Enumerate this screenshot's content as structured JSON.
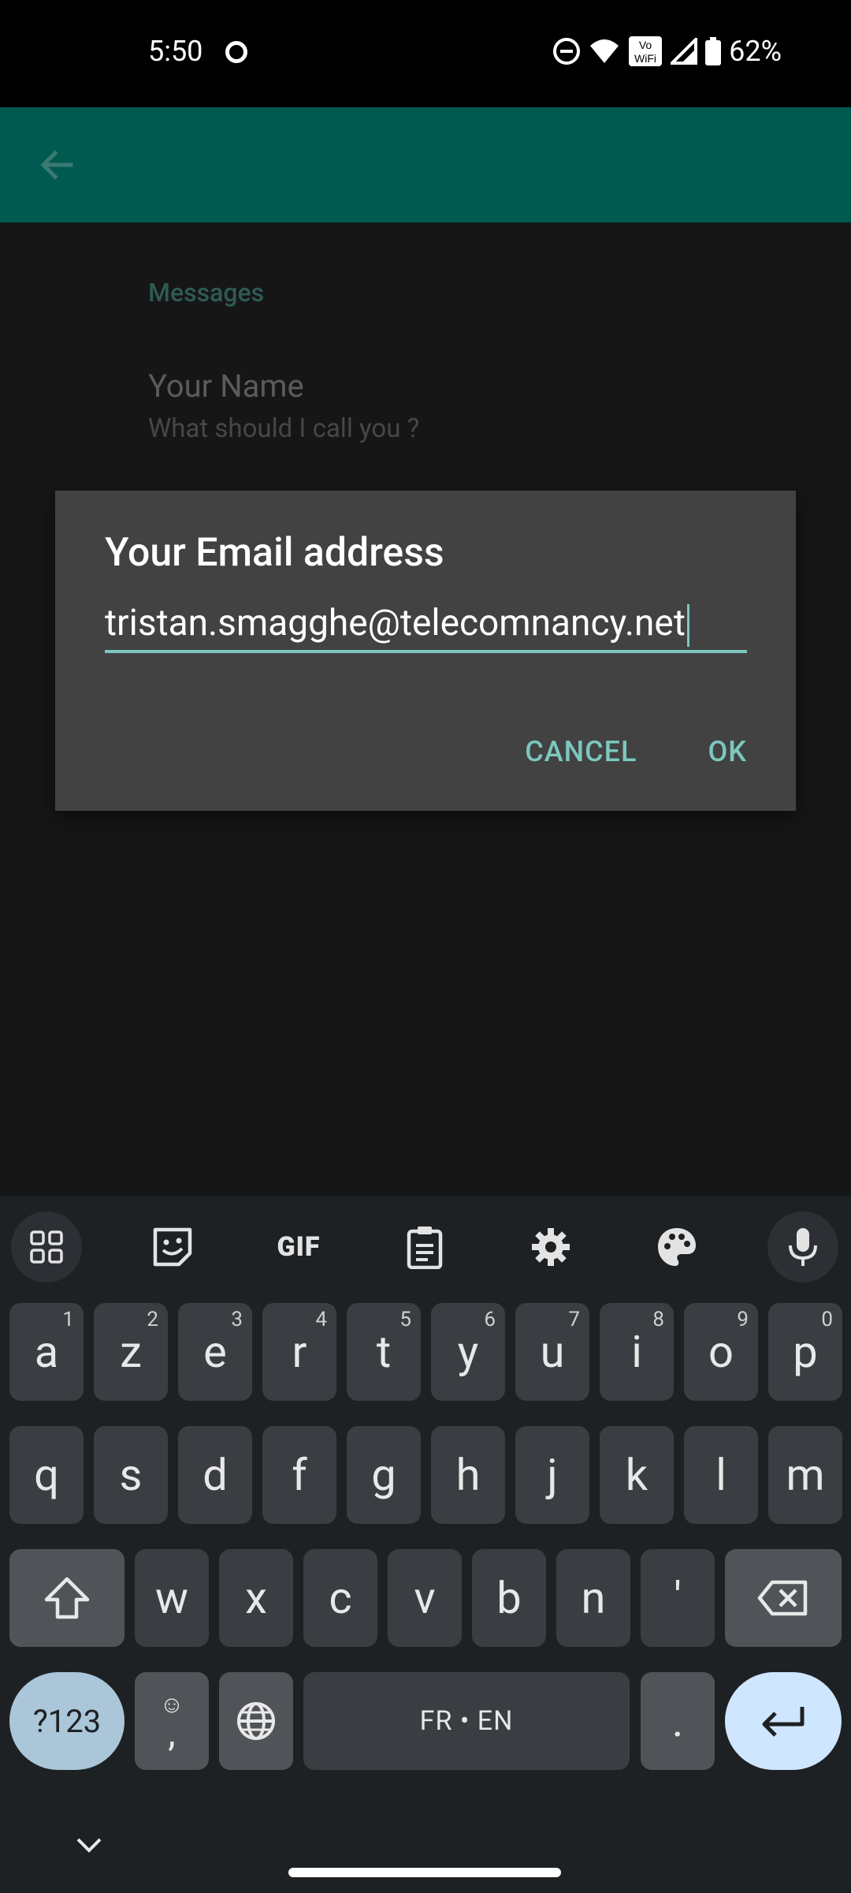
{
  "status_bar": {
    "time": "5:50",
    "battery": "62%",
    "vowifi_label_top": "Vo",
    "vowifi_label_bottom": "WiFi"
  },
  "app_bar": {
    "accent_color": "#015a50"
  },
  "settings": {
    "section_header": "Messages",
    "pref_title": "Your Name",
    "pref_subtitle": "What should I call you ?"
  },
  "dialog": {
    "title": "Your Email address",
    "input_value": "tristan.smagghe@telecomnancy.net",
    "cancel_label": "CANCEL",
    "ok_label": "OK",
    "accent_color": "#7cc7bf"
  },
  "keyboard": {
    "toolbar": {
      "gif_label": "GIF"
    },
    "row1": [
      {
        "key": "a",
        "hint": "1"
      },
      {
        "key": "z",
        "hint": "2"
      },
      {
        "key": "e",
        "hint": "3"
      },
      {
        "key": "r",
        "hint": "4"
      },
      {
        "key": "t",
        "hint": "5"
      },
      {
        "key": "y",
        "hint": "6"
      },
      {
        "key": "u",
        "hint": "7"
      },
      {
        "key": "i",
        "hint": "8"
      },
      {
        "key": "o",
        "hint": "9"
      },
      {
        "key": "p",
        "hint": "0"
      }
    ],
    "row2": [
      "q",
      "s",
      "d",
      "f",
      "g",
      "h",
      "j",
      "k",
      "l",
      "m"
    ],
    "row3": [
      "w",
      "x",
      "c",
      "v",
      "b",
      "n",
      "'"
    ],
    "symbols_label": "?123",
    "comma_label": ",",
    "emoji_label": "☺",
    "space_label": "FR • EN",
    "period_label": "."
  }
}
